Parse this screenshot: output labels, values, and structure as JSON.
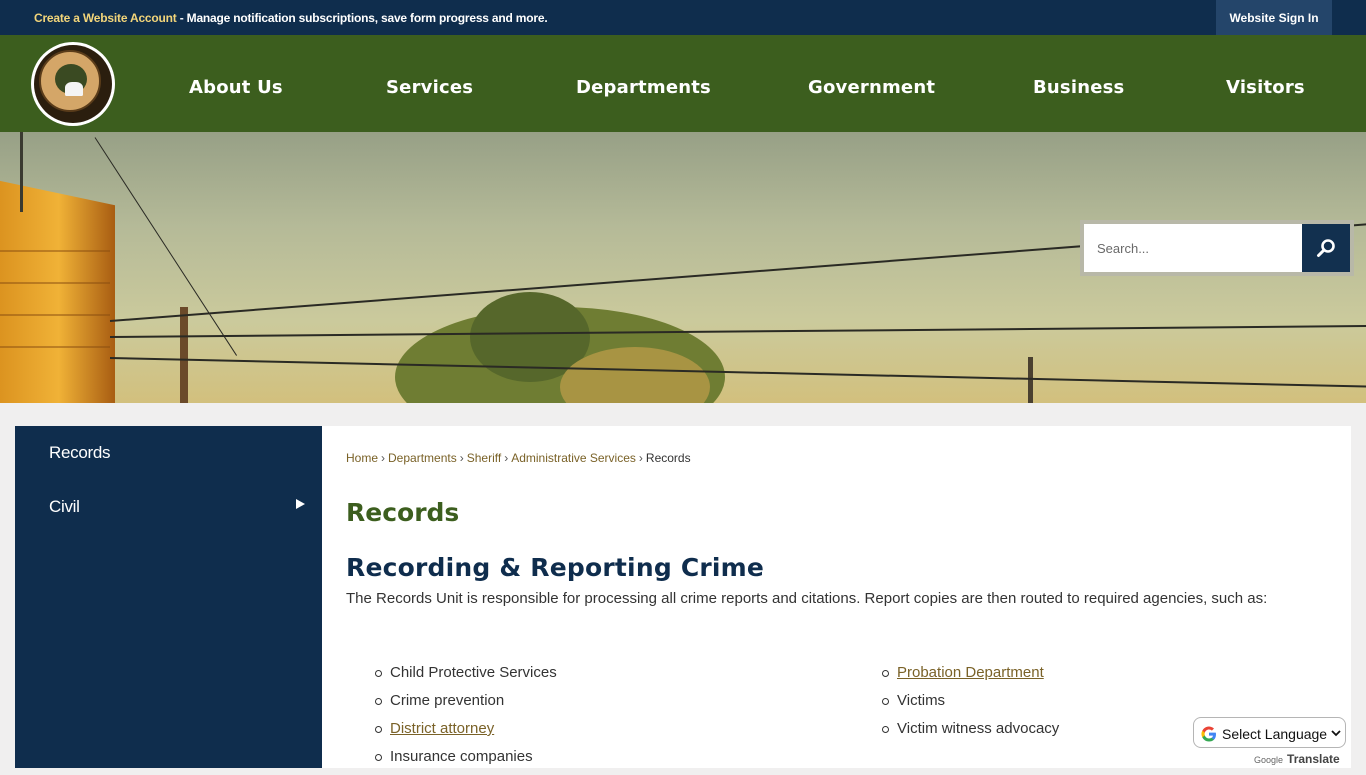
{
  "topbar": {
    "account_link": "Create a Website Account",
    "account_desc": " - Manage notification subscriptions, save form progress and more.",
    "signin_label": "Website Sign In"
  },
  "logo": {
    "alt_text": "Colusa County California"
  },
  "nav": {
    "items": [
      {
        "label": "About Us"
      },
      {
        "label": "Services"
      },
      {
        "label": "Departments"
      },
      {
        "label": "Government"
      },
      {
        "label": "Business"
      },
      {
        "label": "Visitors"
      }
    ]
  },
  "search": {
    "placeholder": "Search..."
  },
  "sidebar": {
    "items": [
      {
        "label": "Records"
      },
      {
        "label": "Civil"
      }
    ]
  },
  "breadcrumb": {
    "items": [
      "Home",
      "Departments",
      "Sheriff",
      "Administrative Services"
    ],
    "current": "Records"
  },
  "page": {
    "title": "Records",
    "subtitle": "Recording & Reporting Crime",
    "intro": "The Records Unit is responsible for processing all crime reports and citations. Report copies are then routed to required agencies, such as:"
  },
  "agencies": {
    "left": [
      {
        "label": "Child Protective Services",
        "link": false
      },
      {
        "label": "Crime prevention",
        "link": false
      },
      {
        "label": "District attorney",
        "link": true
      },
      {
        "label": "Insurance companies",
        "link": false
      }
    ],
    "right": [
      {
        "label": "Probation Department",
        "link": true
      },
      {
        "label": "Victims",
        "link": false
      },
      {
        "label": "Victim witness advocacy",
        "link": false
      }
    ]
  },
  "translate": {
    "select_label": "Select Language",
    "powered_prefix": "Google",
    "powered_word": "Translate"
  },
  "colors": {
    "navy": "#0f2d4d",
    "green": "#3c5e1e",
    "link_gold": "#7a6228",
    "account_link": "#f2d57a"
  }
}
